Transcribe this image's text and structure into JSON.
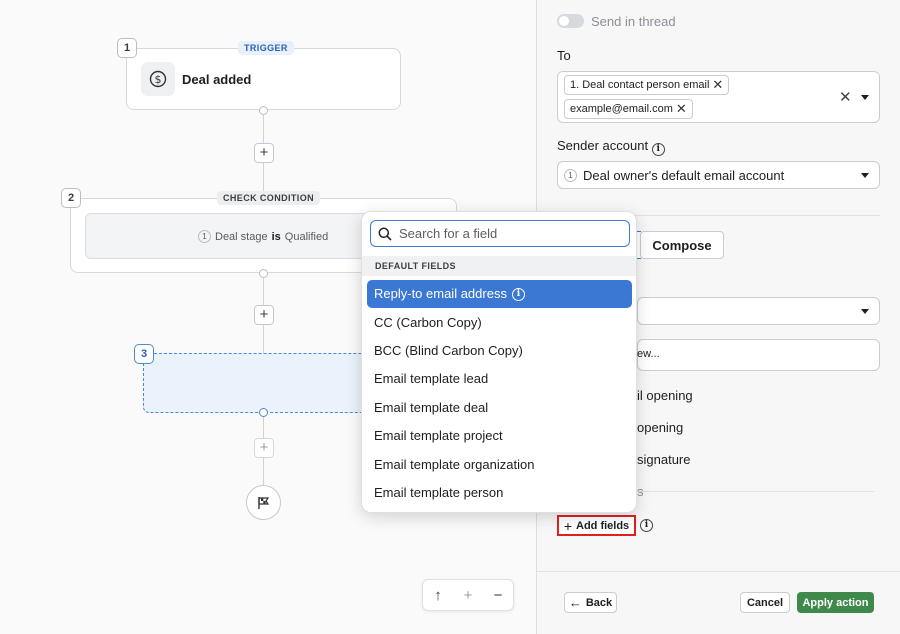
{
  "canvas": {
    "trigger": {
      "step": "1",
      "pill": "TRIGGER",
      "title": "Deal added"
    },
    "condition": {
      "step": "2",
      "pill": "CHECK CONDITION",
      "num": "1",
      "field": "Deal stage",
      "op": "is",
      "value": "Qualified"
    },
    "action": {
      "step": "3"
    },
    "zoom": {
      "up": "↑",
      "plus": "+",
      "minus": "−"
    }
  },
  "popup": {
    "search_placeholder": "Search for a field",
    "section": "DEFAULT FIELDS",
    "options": [
      {
        "label": "Reply-to email address",
        "selected": true
      },
      {
        "label": "CC (Carbon Copy)"
      },
      {
        "label": "BCC (Blind Carbon Copy)"
      },
      {
        "label": "Email template lead"
      },
      {
        "label": "Email template deal"
      },
      {
        "label": "Email template project"
      },
      {
        "label": "Email template organization"
      },
      {
        "label": "Email template person"
      }
    ]
  },
  "panel": {
    "send_in_thread": "Send in thread",
    "to_label": "To",
    "to_chips": [
      "1. Deal contact person email",
      "example@email.com"
    ],
    "sender_label": "Sender account",
    "sender_num": "1",
    "sender_value": "Deal owner's default email account",
    "compose": "Compose",
    "preview_fragment": "ew...",
    "check1_fragment": "il opening",
    "check2_fragment": "opening",
    "check3_fragment": "signature",
    "section_fragment": "s",
    "add_fields": "Add fields",
    "back": "Back",
    "cancel": "Cancel",
    "apply": "Apply action"
  }
}
